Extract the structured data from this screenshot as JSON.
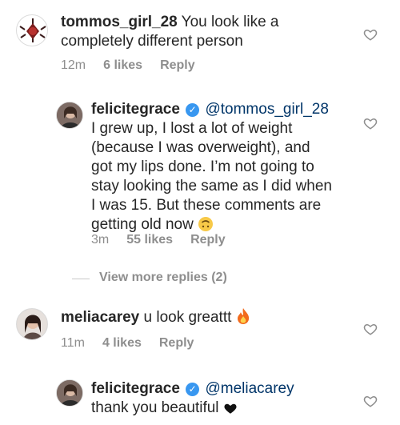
{
  "comments": [
    {
      "username": "tommos_girl_28",
      "text": "You look like a completely different person",
      "time": "12m",
      "likes": "6 likes",
      "reply": "Reply"
    },
    {
      "username": "felicitegrace",
      "mention": "@tommos_girl_28",
      "text": "I grew up, I lost a lot of weight (because I was overweight), and got my lips done. I’m not going to stay looking the same as I did when I was 15. But these comments are getting old now",
      "time": "3m",
      "likes": "55 likes",
      "reply": "Reply"
    },
    {
      "username": "meliacarey",
      "text": "u look greattt",
      "time": "11m",
      "likes": "4 likes",
      "reply": "Reply"
    },
    {
      "username": "felicitegrace",
      "mention": "@meliacarey",
      "text": "thank you beautiful"
    }
  ],
  "view_more": "View more replies (2)",
  "icons": {
    "heart": "heart-outline-icon",
    "verified": "verified-badge-icon"
  }
}
